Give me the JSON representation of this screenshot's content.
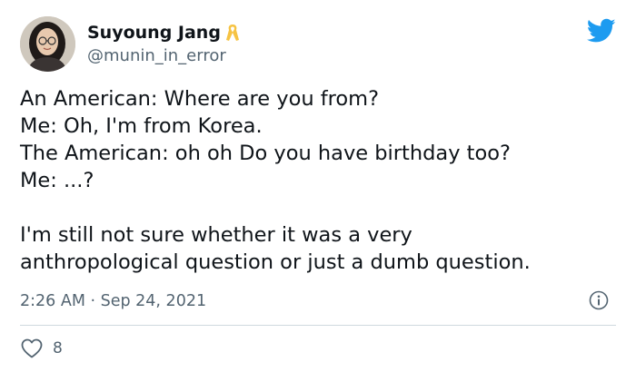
{
  "author": {
    "name": "Suyoung Jang",
    "handle": "@munin_in_error",
    "badge_icon": "awareness-ribbon-icon",
    "badge_color": "#f6c343"
  },
  "brand": {
    "icon": "twitter-bird-icon",
    "color": "#1d9bf0"
  },
  "tweet": {
    "lines": [
      "An American: Where are you from?",
      "Me: Oh, I'm from Korea.",
      "The American: oh oh Do you have birthday too?",
      "Me: ...?",
      "",
      "I'm still not sure whether it was a very",
      "anthropological question or just a dumb question."
    ]
  },
  "meta": {
    "timestamp": "2:26 AM · Sep 24, 2021",
    "info_icon": "info-icon"
  },
  "engagement": {
    "like_icon": "heart-icon",
    "like_count": "8"
  }
}
